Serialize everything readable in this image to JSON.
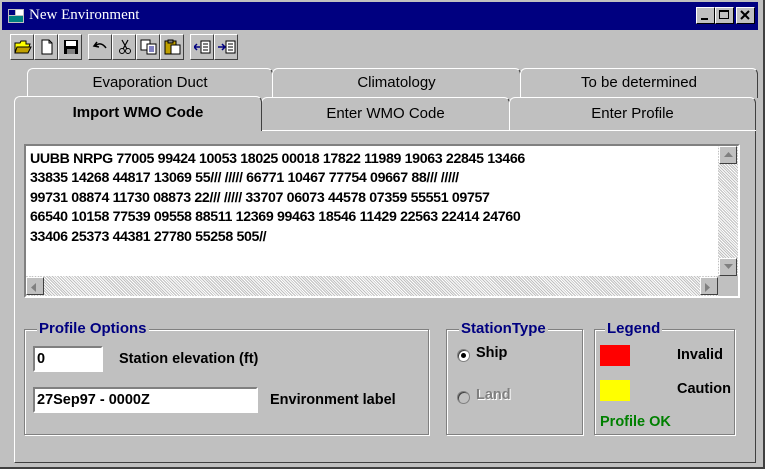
{
  "window": {
    "title": "New Environment",
    "controls": [
      "_",
      "□",
      "×"
    ]
  },
  "toolbar": {
    "buttons": [
      {
        "name": "open-folder-icon"
      },
      {
        "name": "new-file-icon"
      },
      {
        "name": "save-icon"
      },
      {
        "name": "undo-icon"
      },
      {
        "name": "cut-icon"
      },
      {
        "name": "copy-icon"
      },
      {
        "name": "paste-icon"
      },
      {
        "name": "import-icon"
      },
      {
        "name": "export-icon"
      }
    ]
  },
  "tabs": {
    "back_row": [
      "Evaporation Duct",
      "Climatology",
      "To be determined"
    ],
    "front_row": [
      "Import WMO Code",
      "Enter WMO Code",
      "Enter Profile"
    ],
    "active": "Import WMO Code"
  },
  "wmo_code": {
    "lines": [
      "UUBB NRPG 77005 99424 10053 18025 00018 17822 11989 19063 22845 13466",
      "33835 14268 44817 13069 55/// ///// 66771 10467 77754 09667 88/// /////",
      "99731 08874 11730 08873 22/// ///// 33707 06073 44578 07359 55551 09757",
      "66540 10158 77539 09558 88511 12369 99463 18546 11429 22563 22414 24760",
      "33406 25373 44381 27780 55258 505//"
    ]
  },
  "profile_options": {
    "title": "Profile Options",
    "station_elevation_value": "0",
    "station_elevation_label": "Station elevation (ft)",
    "environment_label_value": "27Sep97 - 0000Z",
    "environment_label_label": "Environment label"
  },
  "station_type": {
    "title": "StationType",
    "ship_label": "Ship",
    "land_label": "Land",
    "selected": "Ship"
  },
  "legend": {
    "title": "Legend",
    "invalid_label": "Invalid",
    "invalid_color": "#ff0000",
    "caution_label": "Caution",
    "caution_color": "#ffff00",
    "ok_label": "Profile OK",
    "ok_color": "#008000"
  }
}
